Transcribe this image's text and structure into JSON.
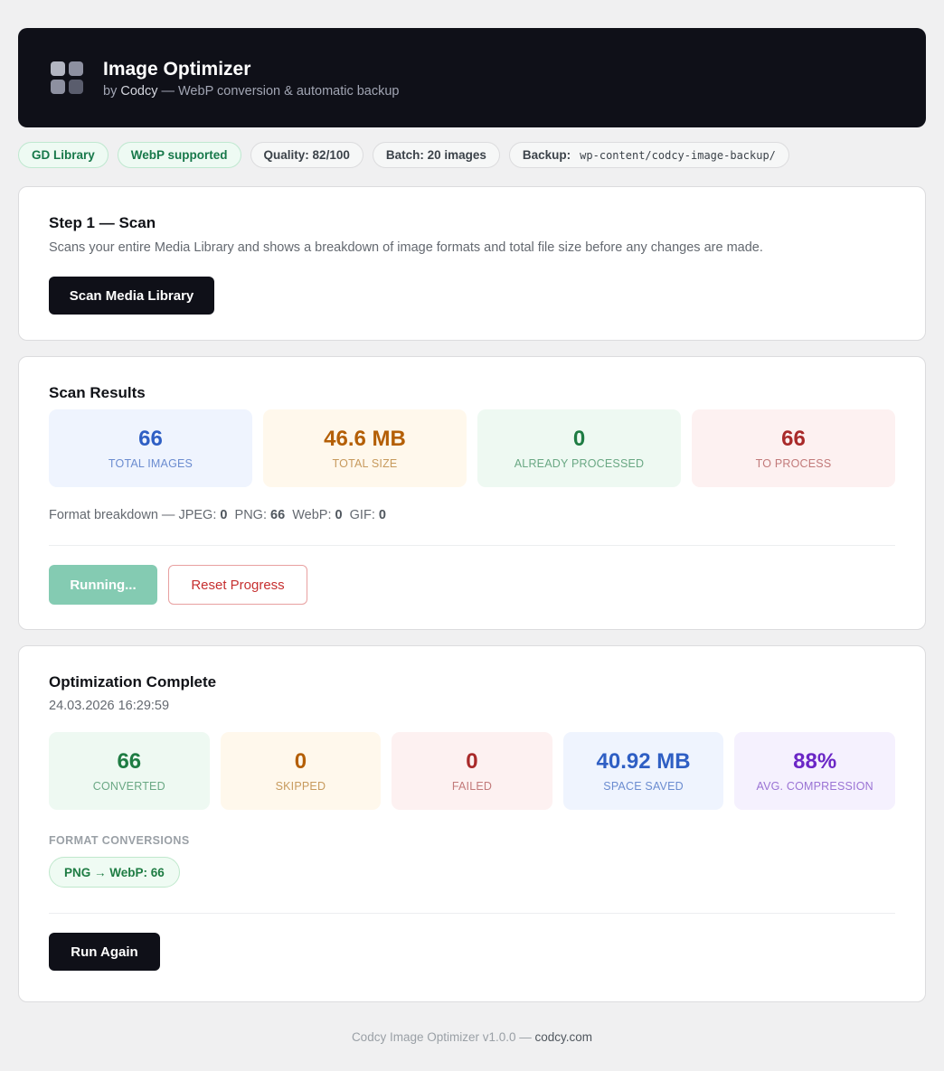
{
  "header": {
    "title": "Image Optimizer",
    "subtitle_prefix": "by ",
    "brand": "Codcy",
    "subtitle_suffix": " — WebP conversion & automatic backup"
  },
  "badges": {
    "library": "GD Library",
    "webp": "WebP supported",
    "quality": "Quality: 82/100",
    "batch": "Batch: 20 images",
    "backup_label": "Backup:",
    "backup_path": "wp-content/codcy-image-backup/"
  },
  "scan_step": {
    "title": "Step 1 — Scan",
    "description": "Scans your entire Media Library and shows a breakdown of image formats and total file size before any changes are made.",
    "button": "Scan Media Library"
  },
  "scan_results": {
    "title": "Scan Results",
    "stats": [
      {
        "value": "66",
        "label": "TOTAL IMAGES"
      },
      {
        "value": "46.6 MB",
        "label": "TOTAL SIZE"
      },
      {
        "value": "0",
        "label": "ALREADY PROCESSED"
      },
      {
        "value": "66",
        "label": "TO PROCESS"
      }
    ],
    "breakdown_prefix": "Format breakdown — ",
    "formats": [
      {
        "name": "JPEG:",
        "count": "0"
      },
      {
        "name": "PNG:",
        "count": "66"
      },
      {
        "name": "WebP:",
        "count": "0"
      },
      {
        "name": "GIF:",
        "count": "0"
      }
    ],
    "running_button": "Running...",
    "reset_button": "Reset Progress"
  },
  "complete": {
    "title": "Optimization Complete",
    "timestamp": "24.03.2026 16:29:59",
    "stats": [
      {
        "value": "66",
        "label": "CONVERTED"
      },
      {
        "value": "0",
        "label": "SKIPPED"
      },
      {
        "value": "0",
        "label": "FAILED"
      },
      {
        "value": "40.92 MB",
        "label": "SPACE SAVED"
      },
      {
        "value": "88%",
        "label": "AVG. COMPRESSION"
      }
    ],
    "conversions_label": "FORMAT CONVERSIONS",
    "conversion_pill": "PNG → WebP: 66",
    "run_again_button": "Run Again"
  },
  "footer": {
    "text": "Codcy Image Optimizer v1.0.0 — ",
    "link": "codcy.com"
  }
}
